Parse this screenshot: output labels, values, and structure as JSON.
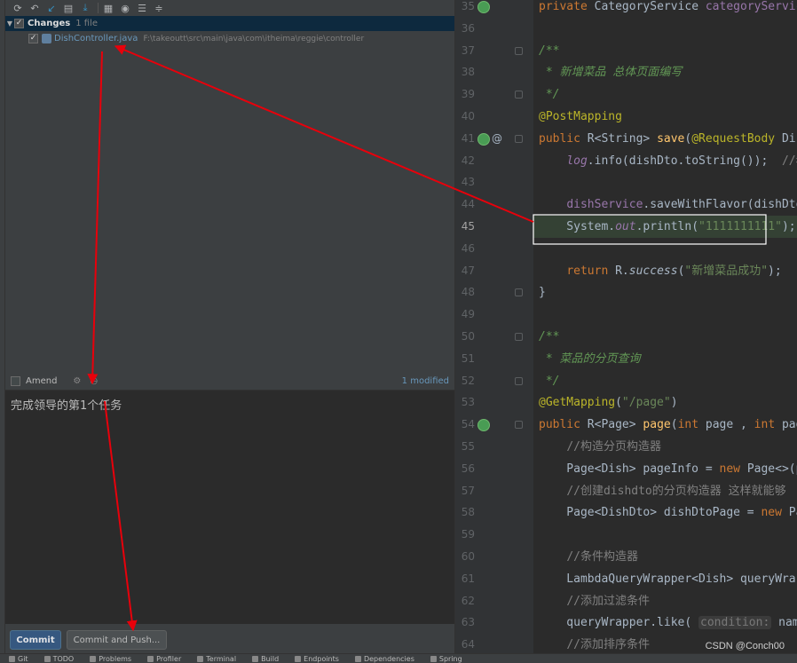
{
  "changes": {
    "title": "Changes",
    "count": "1 file",
    "file": {
      "name": "DishController.java",
      "path": "F:\\takeoutt\\src\\main\\java\\com\\itheima\\reggie\\controller"
    }
  },
  "amend": {
    "label": "Amend",
    "checked": false
  },
  "modified_count": "1 modified",
  "commit_message": "完成领导的第1个任务",
  "buttons": {
    "commit": "Commit",
    "commit_push": "Commit and Push..."
  },
  "editor": {
    "lines": [
      {
        "n": "35",
        "html": "<span class='kw'>private </span>CategoryService <span class='fld'>categoryService</span>;"
      },
      {
        "n": "36",
        "html": ""
      },
      {
        "n": "37",
        "html": "<span class='cmt'>/**</span>"
      },
      {
        "n": "38",
        "html": "<span class='cmt'> * 新增菜品 总体页面编写</span>"
      },
      {
        "n": "39",
        "html": "<span class='cmt'> */</span>"
      },
      {
        "n": "40",
        "html": "<span class='ann'>@PostMapping</span>"
      },
      {
        "n": "41",
        "html": "<span class='kw'>public </span>R&lt;String&gt; <span class='mth'>save</span>(<span class='ann'>@RequestBody</span> Dish"
      },
      {
        "n": "42",
        "html": "    <span class='fld ital'>log</span>.info(dishDto.toString());  <span class='lcmt'>//看看封装上</span>"
      },
      {
        "n": "43",
        "html": ""
      },
      {
        "n": "44",
        "html": "    <span class='fld'>dishService</span>.saveWithFlavor(dishDto);    <span class='lcmt'>//</span>"
      },
      {
        "n": "45",
        "html": "    System.<span class='fld ital'>out</span>.println(<span class='str'>\"1111111111\"</span>);"
      },
      {
        "n": "46",
        "html": ""
      },
      {
        "n": "47",
        "html": "    <span class='kw'>return </span>R.<span class='ital'>success</span>(<span class='str'>\"新增菜品成功\"</span>);"
      },
      {
        "n": "48",
        "html": "}"
      },
      {
        "n": "49",
        "html": ""
      },
      {
        "n": "50",
        "html": "<span class='cmt'>/**</span>"
      },
      {
        "n": "51",
        "html": "<span class='cmt'> * 菜品的分页查询</span>"
      },
      {
        "n": "52",
        "html": "<span class='cmt'> */</span>"
      },
      {
        "n": "53",
        "html": "<span class='ann'>@GetMapping</span>(<span class='str'>\"/page\"</span>)"
      },
      {
        "n": "54",
        "html": "<span class='kw'>public </span>R&lt;Page&gt; <span class='mth'>page</span>(<span class='kw'>int </span>page , <span class='kw'>int </span>pageSiz"
      },
      {
        "n": "55",
        "html": "    <span class='lcmt'>//构造分页构造器</span>"
      },
      {
        "n": "56",
        "html": "    Page&lt;Dish&gt; pageInfo = <span class='kw'>new </span>Page&lt;&gt;(pa"
      },
      {
        "n": "57",
        "html": "    <span class='lcmt'>//创建dishdto的分页构造器 这样就能够</span>"
      },
      {
        "n": "58",
        "html": "    Page&lt;DishDto&gt; dishDtoPage = <span class='kw'>new </span>Pag"
      },
      {
        "n": "59",
        "html": ""
      },
      {
        "n": "60",
        "html": "    <span class='lcmt'>//条件构造器</span>"
      },
      {
        "n": "61",
        "html": "    LambdaQueryWrapper&lt;Dish&gt; queryWra"
      },
      {
        "n": "62",
        "html": "    <span class='lcmt'>//添加过滤条件</span>"
      },
      {
        "n": "63",
        "html": "    queryWrapper.like( <span class='hint'>condition:</span> name!=nu"
      },
      {
        "n": "64",
        "html": "    <span class='lcmt'>//添加排序条件</span>"
      }
    ]
  },
  "statusbar": [
    "Git",
    "TODO",
    "Problems",
    "Profiler",
    "Terminal",
    "Build",
    "Endpoints",
    "Dependencies",
    "Spring"
  ],
  "watermark": "CSDN @Conch00",
  "colors": {
    "annotation_red": "#e8000b",
    "accent": "#365880"
  }
}
